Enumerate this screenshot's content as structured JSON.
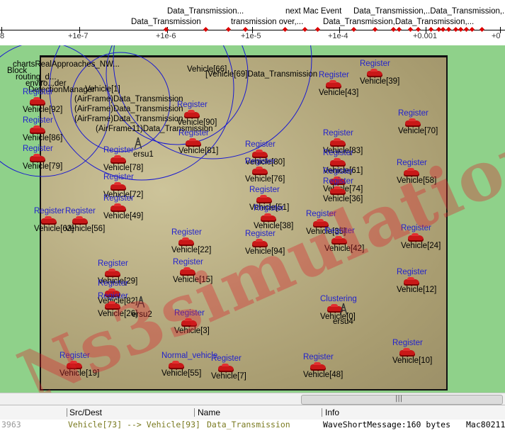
{
  "timeline": {
    "event_labels_row1": [
      "Data_Transmission...",
      "next Mac Event",
      "Data_Transmission,..Data_Transmission,..."
    ],
    "event_labels_row2": [
      "Data_Transmission",
      "transmission over,...",
      "Data_Transmission,Data_Transmission,..."
    ],
    "ticks": [
      "8",
      "+1e-7",
      "+1e-6",
      "+1e-5",
      "+1e-4",
      "+0.001",
      "+0"
    ]
  },
  "canvas": {
    "top_left_labels": [
      "chartsRealApproaches_NW...",
      "Block",
      "routing_d...",
      "enviro...der",
      "DetectionManager"
    ],
    "overlap_labels": [
      "Vehicle[1]",
      "(AirFrame)Data_Transmission",
      "(AirFrame)Data_Transmission",
      "(AirFrame)Data_Transmission",
      "(AirFrame11)Data_Transmission",
      "Vehicle[66]",
      "[Vehicle[69]Data_Transmission"
    ],
    "vehicles": [
      {
        "reg": "Register",
        "name": "Vehicle[92]"
      },
      {
        "reg": "Register",
        "name": "Vehicle[86]"
      },
      {
        "reg": "Register",
        "name": "Vehicle[79]"
      },
      {
        "reg": "Register",
        "name": "Vehicle[78]"
      },
      {
        "reg": "Register",
        "name": "Vehicle[72]"
      },
      {
        "reg": "Register",
        "name": "Vehicle[49]"
      },
      {
        "reg": "Register",
        "name": "Vehicle[63]"
      },
      {
        "reg": "Register",
        "name": "Vehicle[56]"
      },
      {
        "reg": "Register",
        "name": "Vehicle[90]"
      },
      {
        "reg": "Register",
        "name": "Vehicle[81]"
      },
      {
        "reg": "Register",
        "name": "Vehicle[80]"
      },
      {
        "reg": "Register",
        "name": "Vehicle[76]"
      },
      {
        "reg": "Register",
        "name": "Vehicle[51]"
      },
      {
        "reg": "Register",
        "name": "Vehicle[38]"
      },
      {
        "reg": "Register",
        "name": "Vehicle[94]"
      },
      {
        "reg": "Register",
        "name": "Vehicle[39]"
      },
      {
        "reg": "Register",
        "name": "Vehicle[43]"
      },
      {
        "reg": "Register",
        "name": "Vehicle[70]"
      },
      {
        "reg": "Register",
        "name": "Vehicle[83]"
      },
      {
        "reg": "Register",
        "name": "Vehicle[61]"
      },
      {
        "reg": "Register",
        "name": "Vehicle[74]"
      },
      {
        "reg": "Register",
        "name": "Vehicle[36]"
      },
      {
        "reg": "Register",
        "name": "Vehicle[58]"
      },
      {
        "reg": "Register",
        "name": "Vehicle[35]"
      },
      {
        "reg": "Register",
        "name": "Vehicle[42]"
      },
      {
        "reg": "Register",
        "name": "Vehicle[24]"
      },
      {
        "reg": "Register",
        "name": "Vehicle[22]"
      },
      {
        "reg": "Register",
        "name": "Vehicle[15]"
      },
      {
        "reg": "Register",
        "name": "Vehicle[29]"
      },
      {
        "reg": "Register",
        "name": "Vehicle[82]"
      },
      {
        "reg": "Register",
        "name": "Vehicle[26]"
      },
      {
        "reg": "Register",
        "name": "Vehicle[12]"
      },
      {
        "reg": "Register",
        "name": "Vehicle[3]"
      },
      {
        "reg": "Register",
        "name": "Vehicle[10]"
      },
      {
        "reg": "Register",
        "name": "Vehicle[19]"
      },
      {
        "reg": "Normal_vehicle",
        "name": "Vehicle[55]"
      },
      {
        "reg": "Register",
        "name": "Vehicle[7]"
      },
      {
        "reg": "Register",
        "name": "Vehicle[48]"
      },
      {
        "reg": "Clustering",
        "name": "Vehicle[0]"
      }
    ],
    "towers": [
      "ersu1",
      "ersu2",
      "ersu4"
    ],
    "watermark": "Ns3simulation.com"
  },
  "packet_table": {
    "columns": [
      "Src/Dest",
      "Name",
      "Info"
    ],
    "row": {
      "num": "3963",
      "src_dest": "Vehicle[73] --> Vehicle[93]",
      "name": "Data_Transmission",
      "info": "WaveShortMessage:160 bytes",
      "extra": "Mac80211"
    }
  }
}
